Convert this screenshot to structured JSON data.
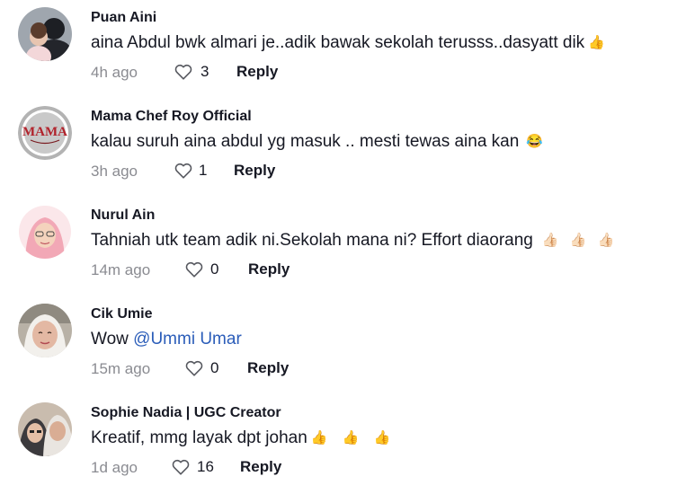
{
  "comments": [
    {
      "username": "Puan Aini",
      "text": "aina Abdul bwk almari je..adik bawak sekolah terusss..dasyatt dik",
      "mention": "",
      "emojis": "👍",
      "time": "4h ago",
      "likes": "3",
      "reply": "Reply",
      "avatar": "avatar-woman-hijab-with-child"
    },
    {
      "username": "Mama Chef Roy Official",
      "text": "kalau suruh aina abdul yg masuk .. mesti tewas aina kan",
      "mention": "",
      "emojis": "😂",
      "time": "3h ago",
      "likes": "1",
      "reply": "Reply",
      "avatar": "avatar-mama-logo",
      "avatar_logo_text": "MAMA"
    },
    {
      "username": "Nurul Ain",
      "text": "Tahniah utk team adik ni.Sekolah mana ni? Effort diaorang",
      "mention": "",
      "emojis": "👍🏻 👍🏻 👍🏻",
      "time": "14m ago",
      "likes": "0",
      "reply": "Reply",
      "avatar": "avatar-woman-pink-hijab-illustration"
    },
    {
      "username": "Cik Umie",
      "text": "Wow ",
      "mention": "@Ummi Umar",
      "emojis": "",
      "time": "15m ago",
      "likes": "0",
      "reply": "Reply",
      "avatar": "avatar-woman-selfie"
    },
    {
      "username": "Sophie Nadia | UGC Creator",
      "text": "Kreatif, mmg layak dpt johan",
      "mention": "",
      "emojis": "👍 👍 👍",
      "time": "1d ago",
      "likes": "16",
      "reply": "Reply",
      "avatar": "avatar-two-people"
    }
  ],
  "colors": {
    "primary_text": "#161823",
    "secondary_text": "#8a8b91",
    "mention": "#2b5db9",
    "background": "#ffffff"
  },
  "icons": {
    "like": "heart-outline-icon"
  }
}
